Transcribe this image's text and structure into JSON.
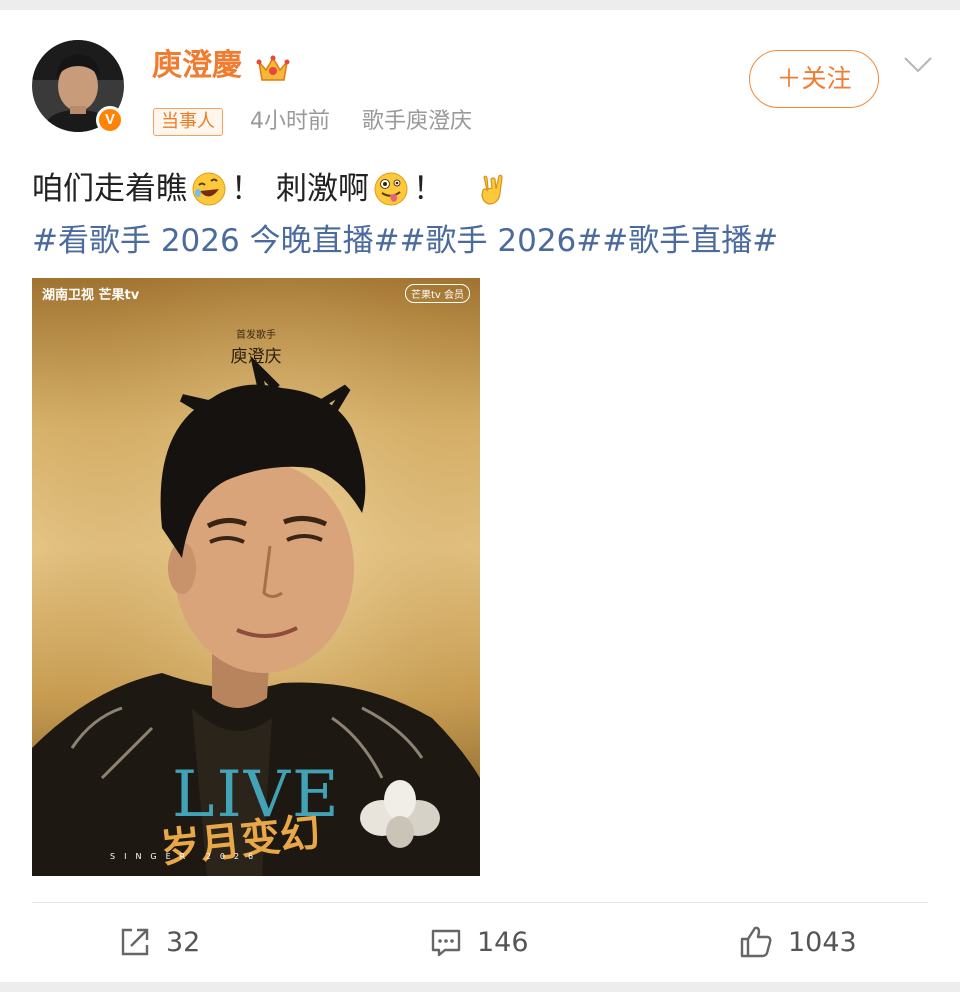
{
  "post": {
    "user": {
      "name": "庾澄慶",
      "avatar_badge": "V",
      "crown_icon": "crown-icon",
      "brand_color": "#f17c2f"
    },
    "meta": {
      "tag": "当事人",
      "time": "4小时前",
      "source": "歌手庾澄庆"
    },
    "follow_label": "＋关注",
    "text": {
      "part1": "咱们走着瞧",
      "excl1": "！",
      "part2": "刺激啊",
      "excl2": "！",
      "emoji1": "rolling-laughing-emoji",
      "emoji2": "zany-face-emoji",
      "emoji3": "rock-hand-emoji"
    },
    "hashtags": [
      "#看歌手 2026 今晚直播#",
      "#歌手 2026#",
      "#歌手直播#"
    ],
    "image": {
      "logos": "湖南卫视  芒果tv",
      "member_badge": "芒果tv 会员",
      "subtitle": "首发歌手",
      "name": "庾澄庆",
      "live_text": "LIVE",
      "title_text": "岁月变幻",
      "singer_text": "SINGER 2026"
    },
    "actions": {
      "repost_count": "32",
      "comment_count": "146",
      "like_count": "1043"
    },
    "colors": {
      "hashtag": "#4b6b9e",
      "meta_gray": "#999999",
      "background": "#ededed"
    }
  }
}
